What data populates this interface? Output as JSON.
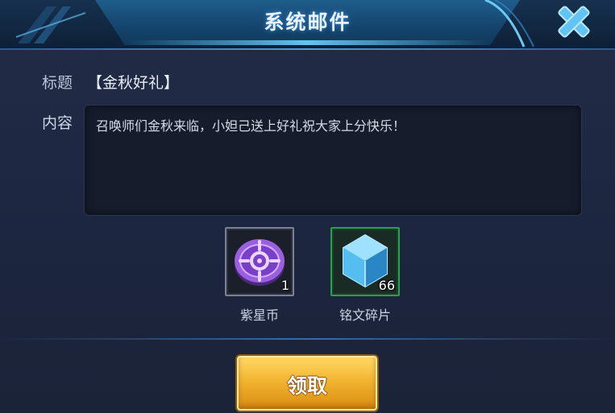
{
  "dialog": {
    "title": "系统邮件"
  },
  "mail": {
    "subject_label": "标题",
    "subject_value": "【金秋好礼】",
    "content_label": "内容",
    "content_text": "召唤师们金秋来临，小妲己送上好礼祝大家上分快乐！"
  },
  "rewards": [
    {
      "name": "紫星币",
      "count": "1",
      "icon": "purple-star-coin-icon"
    },
    {
      "name": "铭文碎片",
      "count": "66",
      "icon": "blue-crystal-icon"
    }
  ],
  "actions": {
    "claim_label": "领取"
  },
  "colors": {
    "header_blue": "#1f5d8c",
    "close_icon": "#62c4f5",
    "reward_2_border": "#2aa04a",
    "claim_gold": "#f2b431"
  }
}
